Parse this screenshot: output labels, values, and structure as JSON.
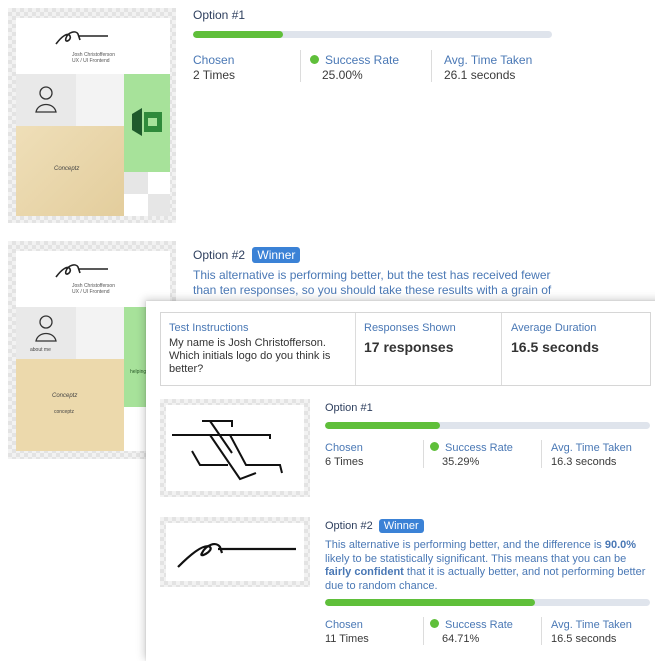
{
  "back": {
    "option1": {
      "title": "Option #1",
      "progress": 0.25,
      "stats": {
        "chosen_label": "Chosen",
        "chosen_value": "2 Times",
        "success_label": "Success Rate",
        "success_value": "25.00%",
        "time_label": "Avg. Time Taken",
        "time_value": "26.1 seconds"
      },
      "thumb": {
        "sig_name": "Josh Christofferson",
        "sig_role": "UX / UI    Frontend",
        "brand": "Conceptz"
      }
    },
    "option2": {
      "title": "Option #2",
      "badge": "Winner",
      "description": "This alternative is performing better, but the test has received fewer than ten responses, so you should take these results with a grain of",
      "thumb": {
        "sig_name": "Josh Christofferson",
        "sig_role": "UX / UI    Frontend",
        "about": "about me",
        "brand": "Conceptz",
        "brand_sub": "conceptz",
        "side": "helping h"
      }
    }
  },
  "front": {
    "summary": {
      "instructions_label": "Test Instructions",
      "instructions_text": "My name is Josh Christofferson. Which initials logo do you think is better?",
      "responses_label": "Responses Shown",
      "responses_value": "17 responses",
      "duration_label": "Average Duration",
      "duration_value": "16.5 seconds"
    },
    "option1": {
      "title": "Option #1",
      "progress": 0.3529,
      "chosen_label": "Chosen",
      "chosen_value": "6 Times",
      "success_label": "Success Rate",
      "success_value": "35.29%",
      "time_label": "Avg. Time Taken",
      "time_value": "16.3 seconds"
    },
    "option2": {
      "title": "Option #2",
      "badge": "Winner",
      "desc_a": "This alternative is performing better, and the difference is ",
      "desc_pct": "90.0%",
      "desc_b": " likely to be statistically significant. This means that you can be ",
      "desc_conf": "fairly confident",
      "desc_c": " that it is actually better, and not performing better due to random chance.",
      "progress": 0.6471,
      "chosen_label": "Chosen",
      "chosen_value": "11 Times",
      "success_label": "Success Rate",
      "success_value": "64.71%",
      "time_label": "Avg. Time Taken",
      "time_value": "16.5 seconds"
    }
  },
  "colors": {
    "accent_green": "#5fbf3a",
    "badge_blue": "#3b82d6",
    "text_blue": "#4a78b5"
  }
}
